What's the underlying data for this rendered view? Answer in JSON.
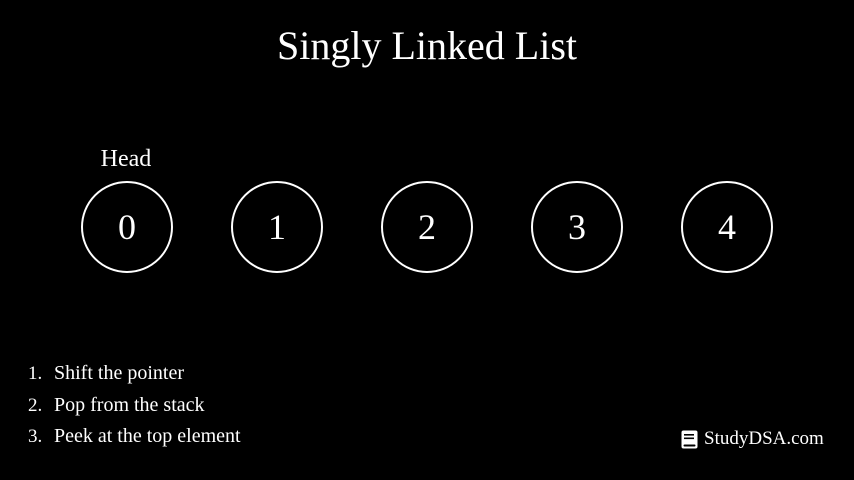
{
  "title": "Singly Linked List",
  "head_label": "Head",
  "nodes": [
    "0",
    "1",
    "2",
    "3",
    "4"
  ],
  "steps": [
    {
      "num": "1.",
      "text": "Shift the pointer"
    },
    {
      "num": "2.",
      "text": "Pop from the stack"
    },
    {
      "num": "3.",
      "text": "Peek at the top element"
    }
  ],
  "brand": {
    "icon": "book-icon",
    "text": "StudyDSA.com"
  },
  "colors": {
    "background": "#000000",
    "foreground": "#ffffff"
  }
}
